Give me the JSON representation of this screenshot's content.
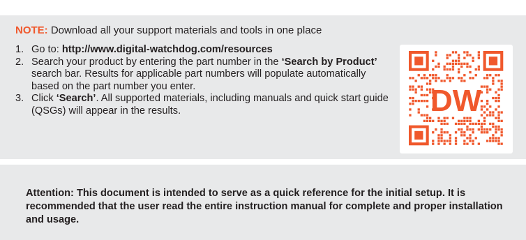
{
  "note": {
    "label": "NOTE:",
    "text": " Download all your support materials and tools in one place"
  },
  "steps": [
    {
      "num": "1.",
      "text_a": "Go to: ",
      "bold_a": "http://www.digital-watchdog.com/resources",
      "text_b": ""
    },
    {
      "num": "2.",
      "text_a": "Search your product by entering the part number in the ",
      "bold_a": "‘Search by Product’",
      "text_b": " search bar. Results for applicable part numbers will populate automatically based on the part number you enter."
    },
    {
      "num": "3.",
      "text_a": "Click ",
      "bold_a": "‘Search’",
      "text_b": ". All supported materials, including manuals and quick start guide (QSGs) will appear in the results."
    }
  ],
  "qr": {
    "logo_text": "DW",
    "accent_color": "#f0582c"
  },
  "attention": {
    "text": "Attention: This document is intended to serve as a quick reference for the initial setup. It is recommended that the user read the entire instruction manual for complete and proper installation and usage."
  }
}
